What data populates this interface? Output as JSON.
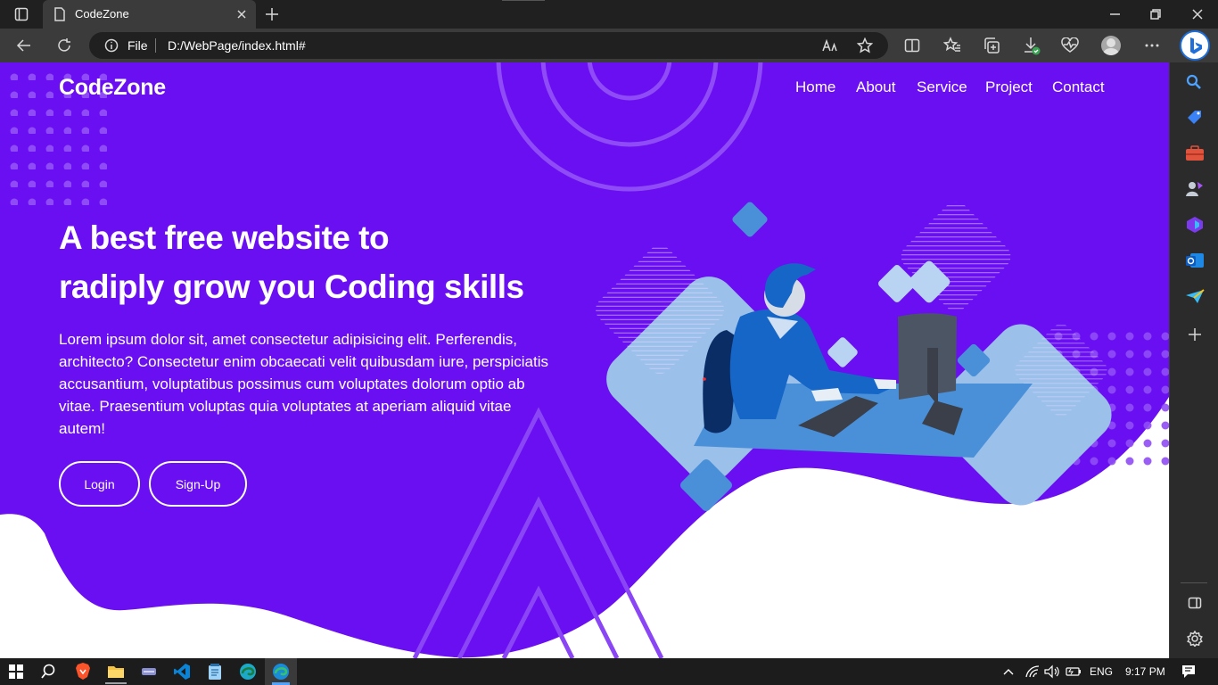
{
  "browser": {
    "tab_title": "CodeZone",
    "url_scheme_label": "File",
    "url": "D:/WebPage/index.html#"
  },
  "site": {
    "logo": "CodeZone",
    "nav": [
      "Home",
      "About",
      "Service",
      "Project",
      "Contact"
    ],
    "hero": {
      "title_line1": "A best free website to",
      "title_line2": "radiply grow you Coding skills",
      "paragraph": "Lorem ipsum dolor sit, amet consectetur adipisicing elit. Perferendis, architecto? Consectetur enim obcaecati velit quibusdam iure, perspiciatis accusantium, voluptatibus possimus cum voluptates dolorum optio ab vitae. Praesentium voluptas quia voluptates at aperiam aliquid vitae autem!",
      "login_label": "Login",
      "signup_label": "Sign-Up"
    },
    "colors": {
      "primary": "#6a0ff1",
      "accent_light": "#9bc1eb",
      "accent_blue": "#4a90d9"
    }
  },
  "taskbar": {
    "language": "ENG",
    "time": "9:17 PM"
  }
}
